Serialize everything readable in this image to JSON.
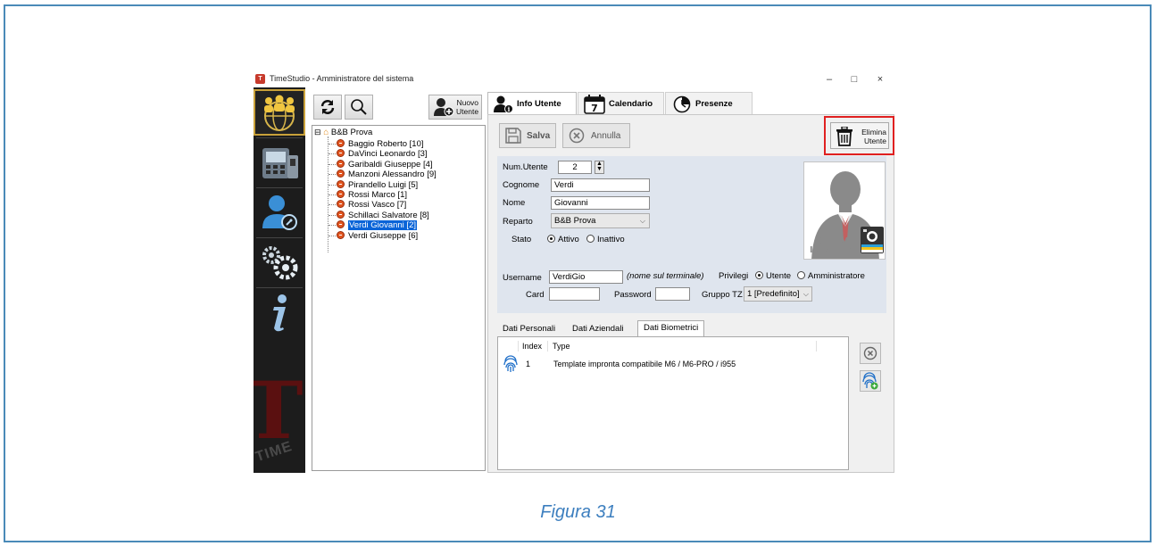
{
  "window": {
    "title": "TimeStudio - Amministratore del sistema",
    "controls": {
      "minimize": "–",
      "maximize": "□",
      "close": "×"
    }
  },
  "toolbar": {
    "new_user_label_1": "Nuovo",
    "new_user_label_2": "Utente"
  },
  "tree": {
    "root": "B&B Prova",
    "expander": "⊟",
    "users": [
      "Baggio Roberto [10]",
      "DaVinci Leonardo [3]",
      "Garibaldi Giuseppe [4]",
      "Manzoni Alessandro [9]",
      "Pirandello Luigi [5]",
      "Rossi Marco [1]",
      "Rossi Vasco [7]",
      "Schillaci Salvatore [8]",
      "Verdi Giovanni [2]",
      "Verdi Giuseppe [6]"
    ],
    "selected_index": 8
  },
  "tabs": [
    {
      "label": "Info Utente",
      "icon": "user-info-icon"
    },
    {
      "label": "Calendario",
      "icon": "calendar-icon",
      "day": "7"
    },
    {
      "label": "Presenze",
      "icon": "clock-icon"
    }
  ],
  "actions": {
    "save": "Salva",
    "cancel": "Annulla",
    "delete_1": "Elimina",
    "delete_2": "Utente"
  },
  "form": {
    "num_utente_label": "Num.Utente",
    "num_utente_value": "2",
    "cognome_label": "Cognome",
    "cognome_value": "Verdi",
    "nome_label": "Nome",
    "nome_value": "Giovanni",
    "reparto_label": "Reparto",
    "reparto_value": "B&B Prova",
    "stato_label": "Stato",
    "stato_attivo": "Attivo",
    "stato_inattivo": "Inattivo",
    "username_label": "Username",
    "username_value": "VerdiGio",
    "username_hint": "(nome sul terminale)",
    "privilegi_label": "Privilegi",
    "priv_utente": "Utente",
    "priv_admin": "Amministratore",
    "card_label": "Card",
    "card_value": "",
    "password_label": "Password",
    "password_value": "",
    "gruppo_label": "Gruppo TZ",
    "gruppo_value": "1 [Predefinito]"
  },
  "photo": {
    "caption_1": "CARICA",
    "caption_2": "IMMAGINE"
  },
  "subtabs": [
    "Dati Personali",
    "Dati Aziendali",
    "Dati Biometrici"
  ],
  "biometric_table": {
    "columns": [
      "Index",
      "Type"
    ],
    "rows": [
      {
        "index": "1",
        "type": "Template impronta compatibile M6 / M6-PRO / i955"
      }
    ]
  },
  "caption": "Figura 31",
  "colors": {
    "frame": "#4a8ab8",
    "highlight": "#e02020",
    "selection": "#0a64d8",
    "caption": "#3d7fbf"
  }
}
